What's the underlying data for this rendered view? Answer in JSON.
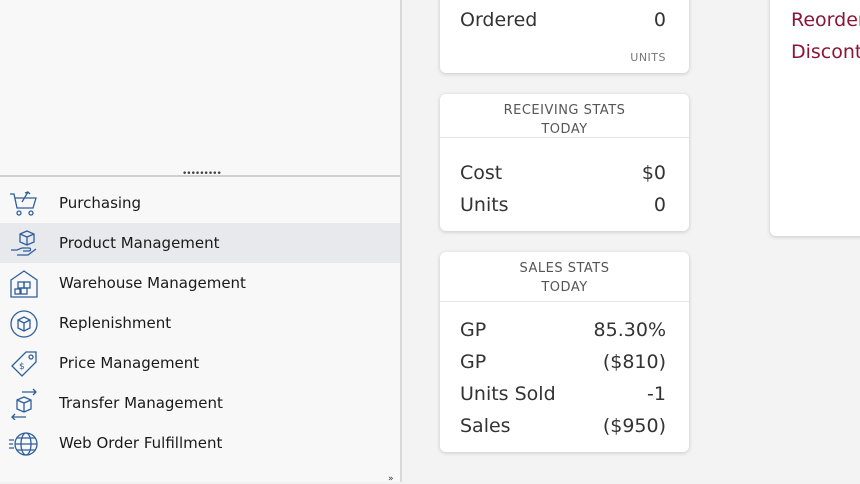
{
  "nav": {
    "items": [
      {
        "label": "Purchasing",
        "icon": "cart-icon"
      },
      {
        "label": "Product Management",
        "icon": "box-hand-icon"
      },
      {
        "label": "Warehouse Management",
        "icon": "warehouse-icon"
      },
      {
        "label": "Replenishment",
        "icon": "replenish-cycle-icon"
      },
      {
        "label": "Price Management",
        "icon": "price-tag-icon"
      },
      {
        "label": "Transfer Management",
        "icon": "transfer-arrows-icon"
      },
      {
        "label": "Web Order Fulfillment",
        "icon": "globe-icon"
      }
    ],
    "active_index": 1
  },
  "grip": "•••••••••",
  "corner_mark": "»",
  "ordered_card": {
    "label": "Ordered",
    "value": "0",
    "note": "UNITS"
  },
  "receiving_card": {
    "title_line1": "RECEIVING STATS",
    "title_line2": "TODAY",
    "rows": [
      {
        "label": "Cost",
        "value": "$0"
      },
      {
        "label": "Units",
        "value": "0"
      }
    ]
  },
  "sales_card": {
    "title_line1": "SALES STATS",
    "title_line2": "TODAY",
    "rows": [
      {
        "label": "GP",
        "value": "85.30%"
      },
      {
        "label": "GP",
        "value": "($810)"
      },
      {
        "label": "Units Sold",
        "value": "-1"
      },
      {
        "label": "Sales",
        "value": "($950)"
      }
    ]
  },
  "links": {
    "reorder": "Reorder",
    "discont": "Discont"
  },
  "colors": {
    "icon_blue": "#2f5f9a",
    "link": "#8a1538",
    "active_bg": "#e8e9ed"
  }
}
